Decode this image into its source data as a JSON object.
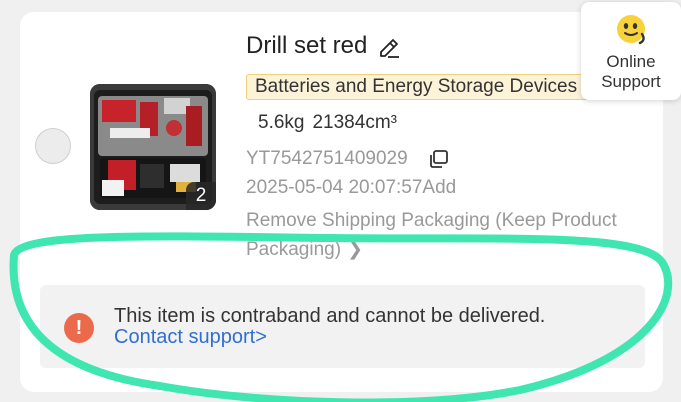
{
  "product": {
    "title": "Drill set red",
    "category_tag": "Batteries and Energy Storage Devices",
    "weight": "5.6kg",
    "volume": "21384cm³",
    "tracking_number": "YT7542751409029",
    "added_time": "2025-05-04 20:07:57Add",
    "service_option": "Remove Shipping Packaging (Keep Product Packaging)",
    "image_count": "2"
  },
  "alert": {
    "message": "This item is contraband and cannot be delivered.",
    "link_text": "Contact support>"
  },
  "support_widget": {
    "label_line1": "Online",
    "label_line2": "Support"
  },
  "colors": {
    "alert_icon": "#ec6a4c",
    "link": "#2f6fd1",
    "tag_bg": "#fdf3d8",
    "annotation_stroke": "#3fe6b0"
  },
  "icons": [
    "edit-icon",
    "copy-icon",
    "chevron-right-icon",
    "warning-icon",
    "support-face-icon"
  ]
}
